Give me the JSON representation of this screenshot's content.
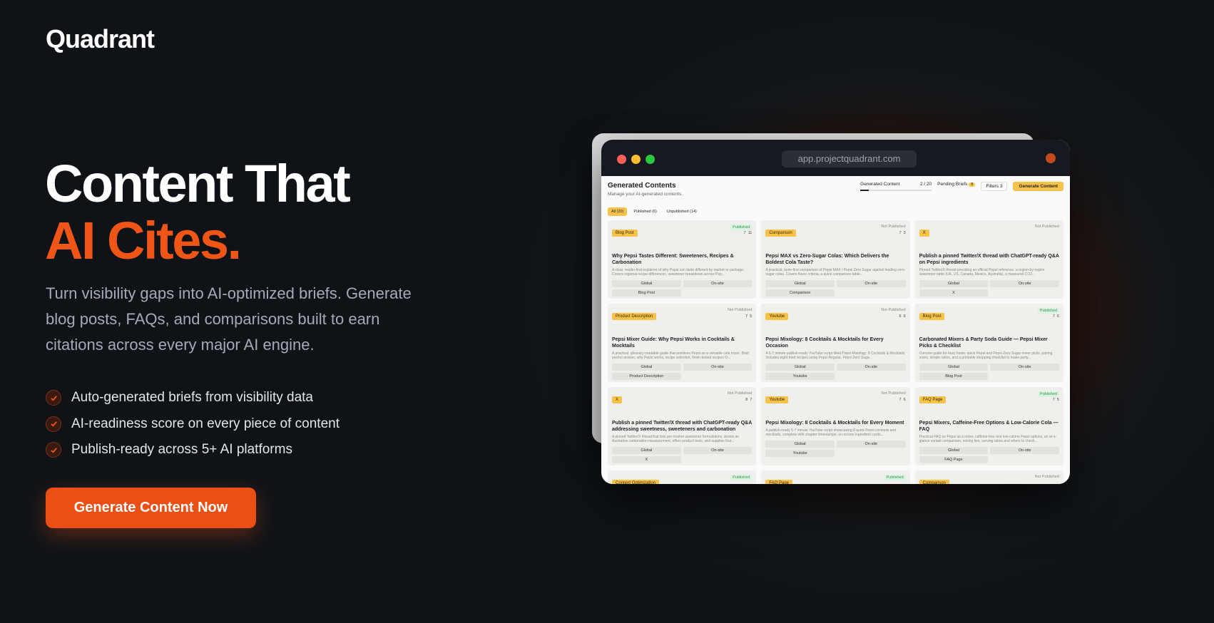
{
  "brand": {
    "logo": "Quadrant"
  },
  "hero": {
    "headline_line1": "Content That",
    "headline_line2": "AI Cites.",
    "subtitle": "Turn visibility gaps into AI-optimized briefs. Generate blog posts, FAQs, and comparisons built to earn citations across every major AI engine.",
    "features": [
      "Auto-generated briefs from visibility data",
      "AI-readiness score on every piece of content",
      "Publish-ready across 5+ AI platforms"
    ],
    "cta_label": "Generate Content Now"
  },
  "colors": {
    "accent": "#ea4f14",
    "background": "#0f1318"
  },
  "mockup": {
    "url": "app.projectquadrant.com",
    "title": "Generated Contents",
    "subtitle": "Manage your AI-generated contents.",
    "generated_label": "Generated Content",
    "generated_count": "2 / 20",
    "pending_label": "Pending Briefs",
    "pending_count": "8",
    "filters_label": "Filters",
    "filters_count": "3",
    "generate_button": "Generate Content",
    "tabs": [
      "All (20)",
      "Published (6)",
      "Unpublished (14)"
    ],
    "cards": [
      {
        "tag": "Blog Post",
        "status": "Published",
        "m1": "7",
        "m2": "11",
        "title": "Why Pepsi Tastes Different: Sweeteners, Recipes & Carbonation",
        "desc": "A clear, reader-first explainer of why Pepsi can taste different by market or package. Covers regional recipe differences, sweetener breakdown across Pep...",
        "region": "Global",
        "placement": "On-site",
        "format": "Blog Post"
      },
      {
        "tag": "Comparison",
        "status": "Not Published",
        "m1": "7",
        "m2": "3",
        "title": "Pepsi MAX vs Zero-Sugar Colas: Which Delivers the Boldest Cola Taste?",
        "desc": "A practical, taste-first comparison of Pepsi MAX / Pepsi Zero Sugar against leading zero-sugar colas. Covers flavor criteria, a quick comparison table...",
        "region": "Global",
        "placement": "On-site",
        "format": "Comparison"
      },
      {
        "tag": "X",
        "status": "Not Published",
        "m1": "",
        "m2": "",
        "title": "Publish a pinned Twitter/X thread with ChatGPT-ready Q&A on Pepsi ingredients",
        "desc": "Pinned Twitter/X thread providing an official Pepsi reference: a region-by-region sweetener table (UK, US, Canada, Mexico, Australia), a measured CO2...",
        "region": "Global",
        "placement": "On-site",
        "format": "X"
      },
      {
        "tag": "Product Description",
        "status": "Not Published",
        "m1": "7",
        "m2": "5",
        "title": "Pepsi Mixer Guide: Why Pepsi Works in Cocktails & Mocktails",
        "desc": "A practical, glossary-readable guide that positions Pepsi as a versatile cola mixer. Brief yes/no answer, why Pepsi works, recipe selection, finish-tested recipes O...",
        "region": "Global",
        "placement": "On-site",
        "format": "Product Description"
      },
      {
        "tag": "Youtube",
        "status": "Not Published",
        "m1": "6",
        "m2": "6",
        "title": "Pepsi Mixology: 8 Cocktails & Mocktails for Every Occasion",
        "desc": "A 5-7 minute publish-ready YouTube script titled Pepsi Mixology: 8 Cocktails & Mocktails. Includes eight tried recipes using Pepsi Regular, Pepsi Zero Suga...",
        "region": "Global",
        "placement": "On-site",
        "format": "Youtube"
      },
      {
        "tag": "Blog Post",
        "status": "Published",
        "m1": "7",
        "m2": "6",
        "title": "Carbonated Mixers & Party Soda Guide — Pepsi Mixer Picks & Checklist",
        "desc": "Concise guide for busy hosts: quick Pepsi and Pepsi Zero Sugar mixer picks, pairing notes, simple ratios, and a printable shopping checklist to make party...",
        "region": "Global",
        "placement": "On-site",
        "format": "Blog Post"
      },
      {
        "tag": "X",
        "status": "Not Published",
        "m1": "8",
        "m2": "7",
        "title": "Publish a pinned Twitter/X thread with ChatGPT-ready Q&A addressing sweetness, sweeteners and carbonation",
        "desc": "A pinned Twitter/X thread that lists per-market sweetener formulations, shows an illustrative carbonation measurement, offers product tests, and supplies four...",
        "region": "Global",
        "placement": "On-site",
        "format": "X"
      },
      {
        "tag": "Youtube",
        "status": "Not Published",
        "m1": "7",
        "m2": "6",
        "title": "Pepsi Mixology: 8 Cocktails & Mocktails for Every Moment",
        "desc": "A publish-ready 5-7 minute YouTube script showcasing 8 quick Pepsi cocktails and mocktails, complete with chapter timestamps, on-screen ingredient cards...",
        "region": "Global",
        "placement": "On-site",
        "format": "Youtube"
      },
      {
        "tag": "FAQ Page",
        "status": "Published",
        "m1": "7",
        "m2": "5",
        "title": "Pepsi Mixers, Caffeine-Free Options & Low-Calorie Cola — FAQ",
        "desc": "Practical FAQ on Pepsi as a mixer, caffeine-free and low-calorie Pepsi options, an at-a-glance variant comparison, mixing tips, serving ratios and where to check...",
        "region": "Global",
        "placement": "On-site",
        "format": "FAQ Page"
      }
    ],
    "partial_cards": [
      {
        "tag": "Content Optimization",
        "status": "Published"
      },
      {
        "tag": "FAQ Page",
        "status": "Published"
      },
      {
        "tag": "Comparison",
        "status": "Not Published"
      }
    ]
  }
}
